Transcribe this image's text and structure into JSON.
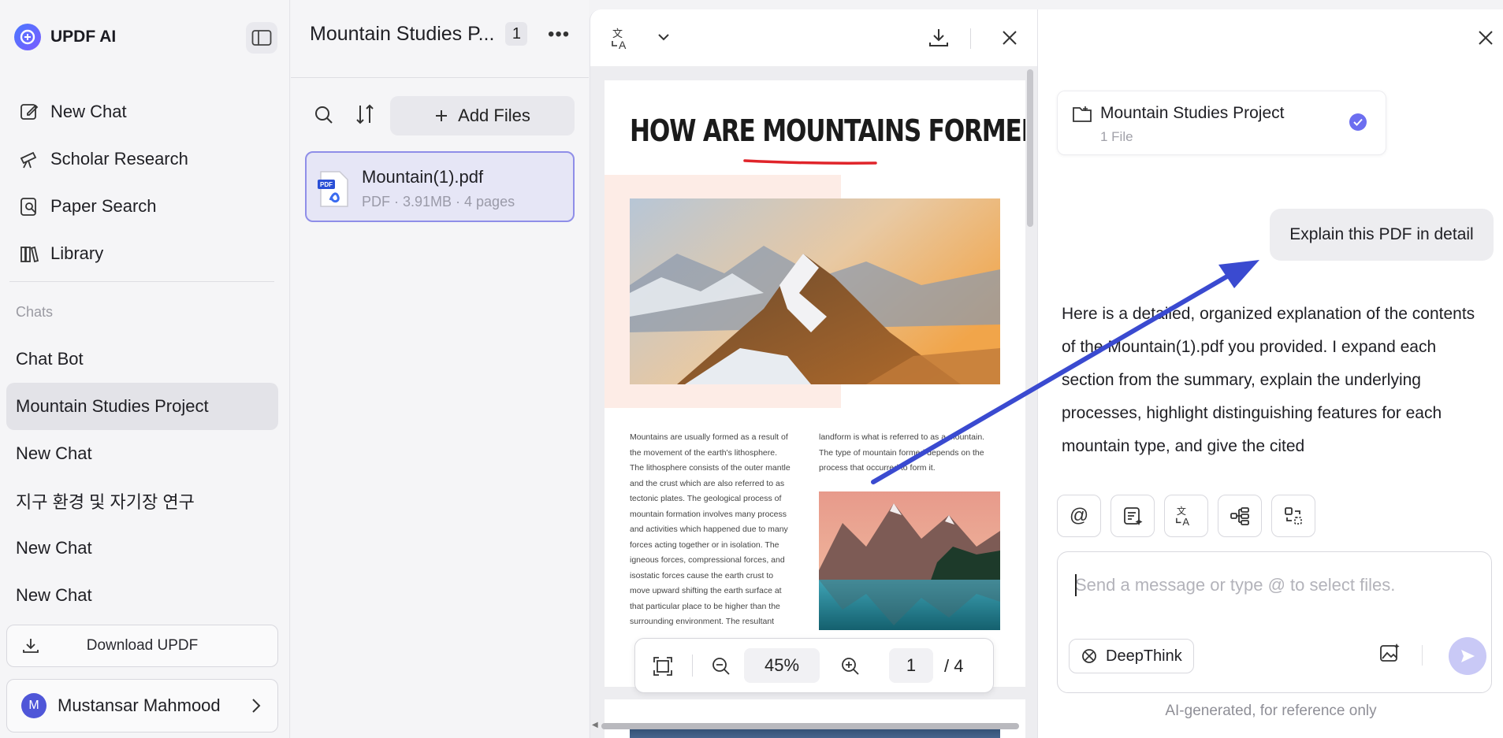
{
  "app": {
    "name": "UPDF AI"
  },
  "sidebar": {
    "nav": [
      {
        "label": "New Chat",
        "icon": "edit-icon"
      },
      {
        "label": "Scholar Research",
        "icon": "telescope-icon"
      },
      {
        "label": "Paper Search",
        "icon": "document-search-icon"
      },
      {
        "label": "Library",
        "icon": "library-icon"
      }
    ],
    "chats_header": "Chats",
    "chats": [
      {
        "label": "Chat Bot",
        "active": false
      },
      {
        "label": "Mountain Studies Project",
        "active": true
      },
      {
        "label": "New Chat",
        "active": false
      },
      {
        "label": "지구 환경 및 자기장 연구",
        "active": false
      },
      {
        "label": "New Chat",
        "active": false
      },
      {
        "label": "New Chat",
        "active": false
      }
    ],
    "download_label": "Download UPDF",
    "user": {
      "initial": "M",
      "name": "Mustansar Mahmood"
    }
  },
  "filepanel": {
    "title": "Mountain Studies P...",
    "count": "1",
    "add_files_label": "Add Files",
    "files": [
      {
        "name": "Mountain(1).pdf",
        "meta": "PDF · 3.91MB · 4 pages"
      }
    ]
  },
  "viewer": {
    "pdf": {
      "title": "HOW ARE MOUNTAINS FORMED?",
      "col1": "Mountains are usually formed as a result of the movement of the earth's lithosphere. The lithosphere consists of the outer mantle and the crust which are also referred to as tectonic plates. The geological process of mountain formation involves many process and activities which happened due to many forces acting together or in isolation. The igneous forces, compressional forces, and isostatic forces cause the earth crust to move upward shifting the earth surface at that particular place to be higher than the surrounding environment. The resultant",
      "col2": "landform is what is referred to as a mountain. The type of mountain formed depends on the process that occurred to form it."
    },
    "zoom": "45%",
    "page": "1",
    "total": "/ 4"
  },
  "chat": {
    "project": {
      "name": "Mountain Studies Project",
      "sub": "1 File"
    },
    "user_message": "Explain this PDF in detail",
    "ai_message": "Here is a detailed, organized explanation of the contents of the Mountain(1).pdf you provided. I expand each section from the summary, explain the underlying processes, highlight distinguishing features for each mountain type, and give the cited",
    "input_placeholder": "Send a message or type @ to select files.",
    "deepthink_label": "DeepThink",
    "disclaimer": "AI-generated, for reference only"
  },
  "colors": {
    "accent": "#6c6ef0",
    "annotation_arrow": "#3a4ad0",
    "selected_card": "#e6e6f6"
  }
}
